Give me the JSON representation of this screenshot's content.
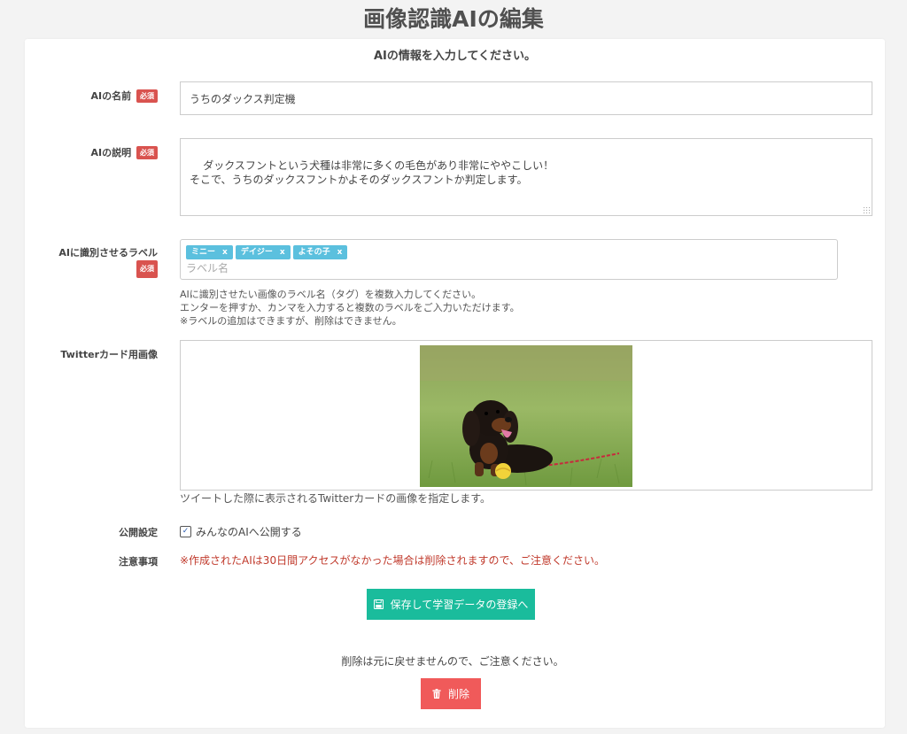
{
  "page": {
    "title": "画像認識AIの編集"
  },
  "form": {
    "heading": "AIの情報を入力してください。",
    "required_badge": "必須",
    "name": {
      "label": "AIの名前",
      "value": "うちのダックス判定機"
    },
    "description": {
      "label": "AIの説明",
      "value": "ダックスフントという犬種は非常に多くの毛色があり非常にややこしい！\nそこで、うちのダックスフントかよそのダックスフントか判定します。"
    },
    "labels": {
      "label": "AIに識別させるラベル",
      "tags": [
        "ミニー",
        "デイジー",
        "よその子"
      ],
      "tag_remove": "x",
      "placeholder": "ラベル名",
      "help_1": "AIに識別させたい画像のラベル名（タグ）を複数入力してください。",
      "help_2": "エンターを押すか、カンマを入力すると複数のラベルをご入力いただけます。",
      "help_3": "※ラベルの追加はできますが、削除はできません。"
    },
    "twitter_image": {
      "label": "Twitterカード用画像",
      "help": "ツイートした際に表示されるTwitterカードの画像を指定します。"
    },
    "visibility": {
      "label": "公開設定",
      "checkbox_label": "みんなのAIへ公開する",
      "checked": true
    },
    "caution": {
      "label": "注意事項",
      "text": "※作成されたAIは30日間アクセスがなかった場合は削除されますので、ご注意ください。"
    },
    "save_button": "保存して学習データの登録へ",
    "delete_note": "削除は元に戻せませんので、ご注意ください。",
    "delete_button": "削除"
  },
  "colors": {
    "save": "#1abc9c",
    "delete": "#f05a5a",
    "required": "#d9534f",
    "tag": "#5bc0de",
    "caution": "#c0392b"
  },
  "icons": {
    "save": "floppy-disk-icon",
    "delete": "trash-icon"
  }
}
